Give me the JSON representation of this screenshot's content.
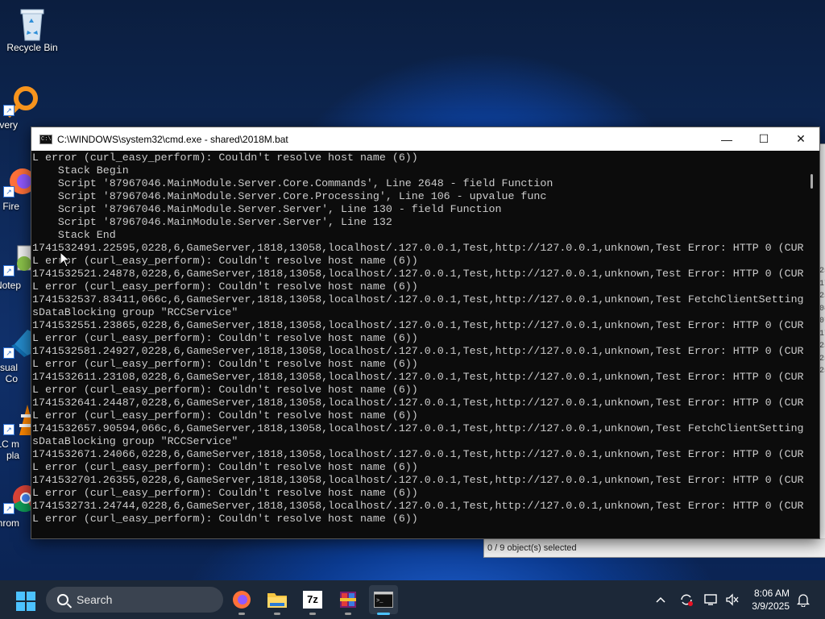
{
  "desktop": {
    "icons": [
      {
        "label": "Recycle Bin"
      },
      {
        "label": "Every"
      },
      {
        "label": "Fire"
      },
      {
        "label": "Notep"
      },
      {
        "label": "Visual\nCo"
      },
      {
        "label": "VLC m\npla"
      },
      {
        "label": "Chrom"
      }
    ]
  },
  "explorer": {
    "status": "0 / 9 object(s) selected",
    "edge_numbers": [
      "25",
      "17",
      "25",
      "08",
      "07",
      "17",
      "25",
      "25",
      "25"
    ]
  },
  "cmd": {
    "title": "C:\\WINDOWS\\system32\\cmd.exe - shared\\2018M.bat",
    "buttons": {
      "minimize": "—",
      "maximize": "☐",
      "close": "✕"
    },
    "lines": [
      "L error (curl_easy_perform): Couldn't resolve host name (6))",
      "    Stack Begin",
      "    Script '87967046.MainModule.Server.Core.Commands', Line 2648 - field Function",
      "    Script '87967046.MainModule.Server.Core.Processing', Line 106 - upvalue func",
      "    Script '87967046.MainModule.Server.Server', Line 130 - field Function",
      "    Script '87967046.MainModule.Server.Server', Line 132",
      "    Stack End",
      "1741532491.22595,0228,6,GameServer,1818,13058,localhost/.127.0.0.1,Test,http://127.0.0.1,unknown,Test Error: HTTP 0 (CUR",
      "L error (curl_easy_perform): Couldn't resolve host name (6))",
      "1741532521.24878,0228,6,GameServer,1818,13058,localhost/.127.0.0.1,Test,http://127.0.0.1,unknown,Test Error: HTTP 0 (CUR",
      "L error (curl_easy_perform): Couldn't resolve host name (6))",
      "1741532537.83411,066c,6,GameServer,1818,13058,localhost/.127.0.0.1,Test,http://127.0.0.1,unknown,Test FetchClientSetting",
      "sDataBlocking group \"RCCService\"",
      "1741532551.23865,0228,6,GameServer,1818,13058,localhost/.127.0.0.1,Test,http://127.0.0.1,unknown,Test Error: HTTP 0 (CUR",
      "L error (curl_easy_perform): Couldn't resolve host name (6))",
      "1741532581.24927,0228,6,GameServer,1818,13058,localhost/.127.0.0.1,Test,http://127.0.0.1,unknown,Test Error: HTTP 0 (CUR",
      "L error (curl_easy_perform): Couldn't resolve host name (6))",
      "1741532611.23108,0228,6,GameServer,1818,13058,localhost/.127.0.0.1,Test,http://127.0.0.1,unknown,Test Error: HTTP 0 (CUR",
      "L error (curl_easy_perform): Couldn't resolve host name (6))",
      "1741532641.24487,0228,6,GameServer,1818,13058,localhost/.127.0.0.1,Test,http://127.0.0.1,unknown,Test Error: HTTP 0 (CUR",
      "L error (curl_easy_perform): Couldn't resolve host name (6))",
      "1741532657.90594,066c,6,GameServer,1818,13058,localhost/.127.0.0.1,Test,http://127.0.0.1,unknown,Test FetchClientSetting",
      "sDataBlocking group \"RCCService\"",
      "1741532671.24066,0228,6,GameServer,1818,13058,localhost/.127.0.0.1,Test,http://127.0.0.1,unknown,Test Error: HTTP 0 (CUR",
      "L error (curl_easy_perform): Couldn't resolve host name (6))",
      "1741532701.26355,0228,6,GameServer,1818,13058,localhost/.127.0.0.1,Test,http://127.0.0.1,unknown,Test Error: HTTP 0 (CUR",
      "L error (curl_easy_perform): Couldn't resolve host name (6))",
      "1741532731.24744,0228,6,GameServer,1818,13058,localhost/.127.0.0.1,Test,http://127.0.0.1,unknown,Test Error: HTTP 0 (CUR",
      "L error (curl_easy_perform): Couldn't resolve host name (6))"
    ]
  },
  "taskbar": {
    "search_label": "Search",
    "apps": [
      {
        "name": "firefox-icon"
      },
      {
        "name": "file-explorer-icon"
      },
      {
        "name": "7zip-icon",
        "label": "7z"
      },
      {
        "name": "winrar-icon"
      },
      {
        "name": "cmd-icon"
      }
    ],
    "clock": {
      "time": "8:06 AM",
      "date": "3/9/2025"
    }
  }
}
